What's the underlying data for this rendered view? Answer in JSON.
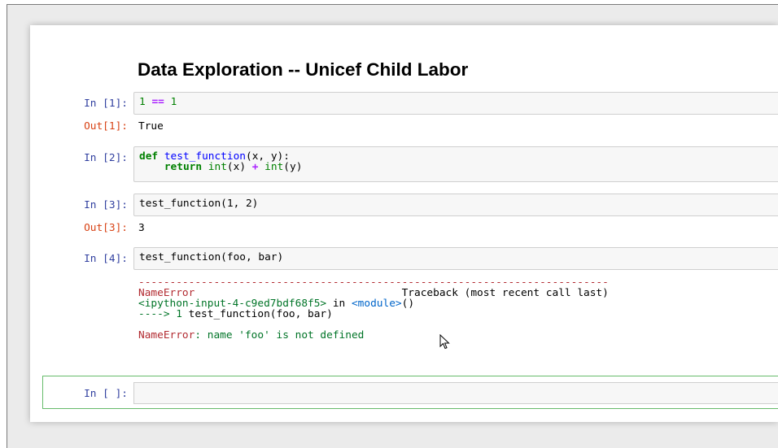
{
  "notebook": {
    "title": "Data Exploration -- Unicef Child Labor"
  },
  "cells": [
    {
      "in_prompt": "In [1]:",
      "code": [
        [
          "1",
          "num"
        ],
        [
          " ",
          ""
        ],
        [
          "==",
          "op"
        ],
        [
          " ",
          ""
        ],
        [
          "1",
          "num"
        ]
      ],
      "out_prompt": "Out[1]:",
      "output": "True"
    },
    {
      "in_prompt": "In [2]:",
      "line1": {
        "kw": "def",
        "name": "test_function",
        "rest": "(x, y):"
      },
      "line2": {
        "indent": "    ",
        "kw": "return",
        "sp": " ",
        "b1": "int",
        "a1": "(x) ",
        "op": "+",
        "sp2": " ",
        "b2": "int",
        "a2": "(y)"
      }
    },
    {
      "in_prompt": "In [3]:",
      "code": "test_function(1, 2)",
      "out_prompt": "Out[3]:",
      "output": "3"
    },
    {
      "in_prompt": "In [4]:",
      "code": "test_function(foo, bar)",
      "traceback": {
        "dashes": "---------------------------------------------------------------------------",
        "error_name": "NameError",
        "header_right": "Traceback (most recent call last)",
        "input_ref": "<ipython-input-4-c9ed7bdf68f5>",
        "in_word": " in ",
        "module": "<module>",
        "module_paren": "()",
        "arrow_line": "----> 1 ",
        "arrow_code": "test_function(foo, bar)",
        "error_message_name": "NameError",
        "error_message": ": name 'foo' is not defined"
      }
    },
    {
      "in_prompt": "In [ ]:",
      "code": ""
    }
  ],
  "colors": {
    "in_prompt": "#303f9f",
    "out_prompt": "#d84315",
    "selected_border": "#66bb6a"
  },
  "icons": {
    "cursor": "mouse-pointer-icon"
  }
}
